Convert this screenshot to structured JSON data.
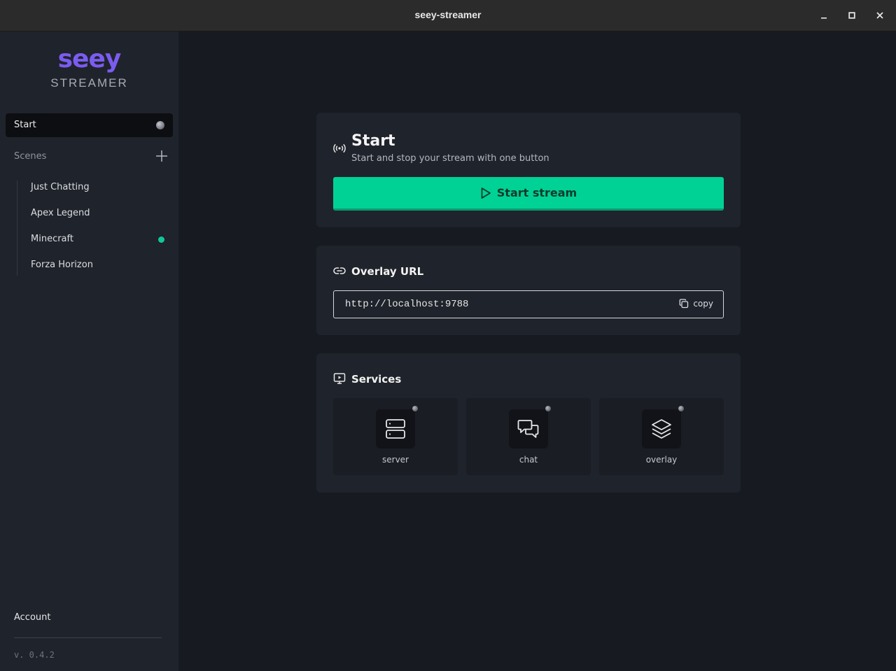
{
  "window": {
    "title": "seey-streamer"
  },
  "sidebar": {
    "logo_main": "seey",
    "logo_sub": "STREAMER",
    "start_label": "Start",
    "scenes_label": "Scenes",
    "scenes": [
      {
        "label": "Just Chatting",
        "active": false
      },
      {
        "label": "Apex Legend",
        "active": false
      },
      {
        "label": "Minecraft",
        "active": true
      },
      {
        "label": "Forza Horizon",
        "active": false
      }
    ],
    "account_label": "Account",
    "version": "v. 0.4.2"
  },
  "start_card": {
    "title": "Start",
    "subtitle": "Start and stop your stream with one button",
    "button_label": "Start stream"
  },
  "overlay_card": {
    "title": "Overlay URL",
    "url": "http://localhost:9788",
    "copy_label": "copy"
  },
  "services_card": {
    "title": "Services",
    "services": [
      {
        "label": "server",
        "icon": "server-icon"
      },
      {
        "label": "chat",
        "icon": "chat-icon"
      },
      {
        "label": "overlay",
        "icon": "layers-icon"
      }
    ]
  },
  "colors": {
    "accent": "#00d295",
    "brand": "#7b5cf0",
    "active_dot": "#10c79a"
  }
}
